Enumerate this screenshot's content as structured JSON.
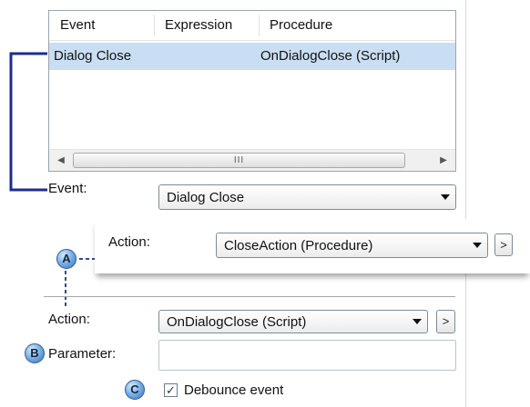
{
  "grid": {
    "columns": [
      "Event",
      "Expression",
      "Procedure"
    ],
    "rows": [
      {
        "event": "Dialog Close",
        "expression": "",
        "procedure": "OnDialogClose (Script)"
      }
    ],
    "scroll_thumb_glyph": "III",
    "scroll_left_glyph": "◀",
    "scroll_right_glyph": "▶"
  },
  "form": {
    "event_label": "Event:",
    "event_value": "Dialog Close",
    "popout_action_label": "Action:",
    "popout_action_value": "CloseAction (Procedure)",
    "popout_more_label": ">",
    "action_label": "Action:",
    "action_value": "OnDialogClose (Script)",
    "action_more_label": ">",
    "parameter_label": "Parameter:",
    "parameter_value": "",
    "debounce_label": "Debounce event",
    "debounce_checked": true,
    "check_glyph": "✓"
  },
  "callouts": {
    "a": "A",
    "b": "B",
    "c": "C"
  },
  "colors": {
    "selection": "#c9def2",
    "bracket": "#1f2d8a",
    "badge": "#6fa6df"
  }
}
